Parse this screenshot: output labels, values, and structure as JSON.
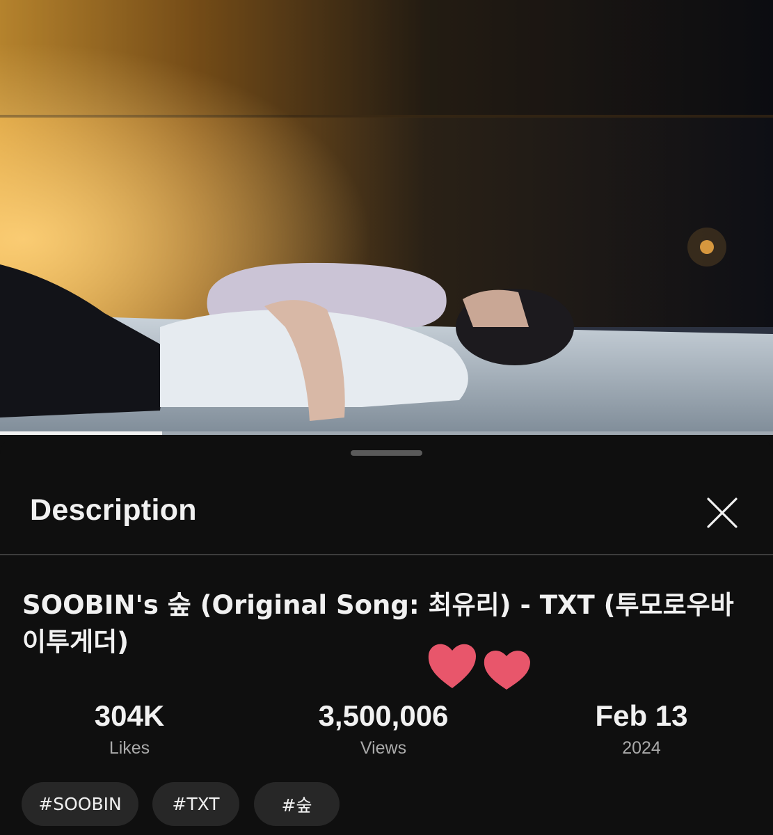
{
  "video": {
    "progress_fraction": 0.21
  },
  "sheet": {
    "title": "Description",
    "close_icon": "close-icon"
  },
  "video_title": "SOOBIN's 숲 (Original Song: 최유리) - TXT (투모로우바이투게더)",
  "stats": {
    "likes": {
      "value": "304K",
      "label": "Likes"
    },
    "views": {
      "value": "3,500,006",
      "label": "Views"
    },
    "date": {
      "value": "Feb 13",
      "label": "2024"
    }
  },
  "hashtags": [
    "#SOOBIN",
    "#TXT",
    "#숲"
  ],
  "sticker": {
    "icon": "hearts-sticker",
    "color": "#e8566b"
  },
  "colors": {
    "background": "#0f0f0f",
    "chip": "#272727",
    "secondary_text": "#aaaaaa"
  }
}
